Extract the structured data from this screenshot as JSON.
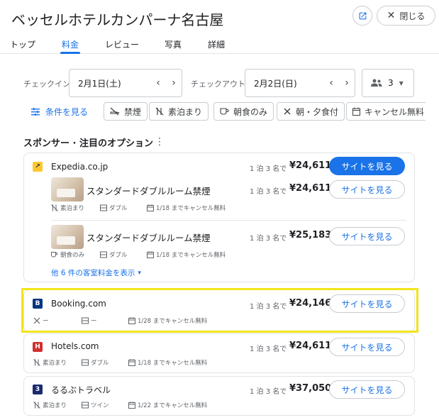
{
  "hotel_name": "ベッセルホテルカンパーナ名古屋",
  "close_label": "閉じる",
  "tabs": [
    {
      "label": "トップ"
    },
    {
      "label": "料金"
    },
    {
      "label": "レビュー"
    },
    {
      "label": "写真"
    },
    {
      "label": "詳細"
    }
  ],
  "checkin": {
    "label": "チェックイン",
    "value": "2月1日(土)"
  },
  "checkout": {
    "label": "チェックアウト",
    "value": "2月2日(日)"
  },
  "guests": {
    "count": "3"
  },
  "filters": {
    "link": "条件を見る",
    "chips": [
      "禁煙",
      "素泊まり",
      "朝食のみ",
      "朝・夕食付",
      "キャンセル無料"
    ]
  },
  "section_title": "スポンサー · 注目のオプション",
  "providers": [
    {
      "name": "Expedia.co.jp",
      "logo": "↗",
      "logo_color": "#ffc72c",
      "per_night": "1 泊 3 名で",
      "price": "¥24,611",
      "button": "サイトを見る",
      "rooms": [
        {
          "name": "スタンダードダブルルーム禁煙",
          "per_night": "1 泊 3 名で",
          "price": "¥24,611",
          "button": "サイトを見る",
          "meal": "素泊まり",
          "bed": "ダブル",
          "cancel": "1/18 までキャンセル無料"
        },
        {
          "name": "スタンダードダブルルーム禁煙",
          "per_night": "1 泊 3 名で",
          "price": "¥25,183",
          "button": "サイトを見る",
          "meal": "朝食のみ",
          "bed": "ダブル",
          "cancel": "1/18 までキャンセル無料"
        }
      ],
      "more_rates": "他 6 件の客室料金を表示"
    },
    {
      "name": "Booking.com",
      "logo": "B",
      "logo_color": "#003580",
      "per_night": "1 泊 3 名で",
      "price": "¥24,146",
      "button": "サイトを見る",
      "meal": "ー",
      "bed": "ー",
      "cancel": "1/28 までキャンセル無料"
    },
    {
      "name": "Hotels.com",
      "logo": "H",
      "logo_color": "#d32f2f",
      "per_night": "1 泊 3 名で",
      "price": "¥24,611",
      "button": "サイトを見る",
      "meal": "素泊まり",
      "bed": "ダブル",
      "cancel": "1/18 までキャンセル無料"
    },
    {
      "name": "るるぶトラベル",
      "logo": "3",
      "logo_color": "#1a2a6c",
      "per_night": "1 泊 3 名で",
      "price": "¥37,050",
      "button": "サイトを見る",
      "meal": "素泊まり",
      "bed": "ツイン",
      "cancel": "1/22 までキャンセル無料"
    }
  ]
}
